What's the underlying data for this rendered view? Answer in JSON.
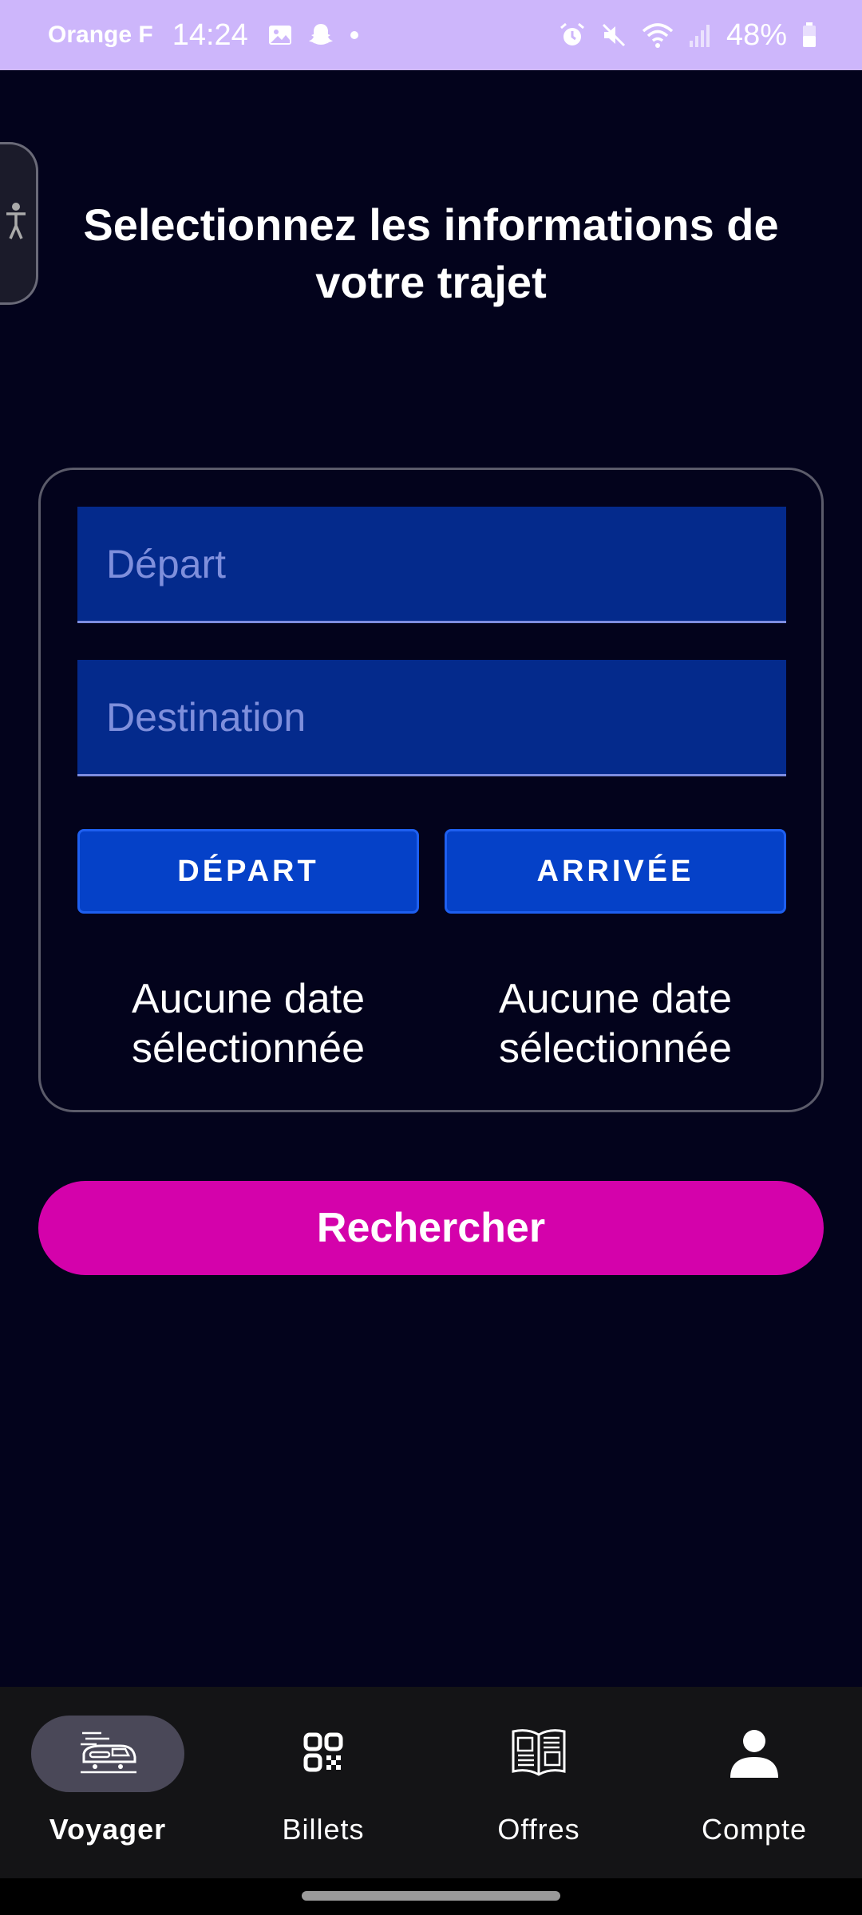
{
  "status_bar": {
    "carrier": "Orange F",
    "time": "14:24",
    "battery": "48%",
    "icons": [
      "image-icon",
      "snapchat-icon",
      "dot-icon",
      "alarm-icon",
      "mute-icon",
      "wifi-icon",
      "signal-icon",
      "battery-icon"
    ]
  },
  "page": {
    "title": "Selectionnez les informations de votre trajet"
  },
  "form": {
    "depart_placeholder": "Départ",
    "destination_placeholder": "Destination",
    "depart_button": "DÉPART",
    "arrivee_button": "ARRIVÉE",
    "depart_date_text": "Aucune date sélectionnée",
    "arrivee_date_text": "Aucune date sélectionnée"
  },
  "search_button": "Rechercher",
  "bottom_nav": {
    "items": [
      {
        "label": "Voyager",
        "icon": "train-icon",
        "active": true
      },
      {
        "label": "Billets",
        "icon": "qr-code-icon",
        "active": false
      },
      {
        "label": "Offres",
        "icon": "book-icon",
        "active": false
      },
      {
        "label": "Compte",
        "icon": "person-icon",
        "active": false
      }
    ]
  },
  "colors": {
    "background": "#03031c",
    "status_bar": "#cdb6fb",
    "field": "#042a8c",
    "date_button": "#0541c8",
    "search_button": "#d402ab",
    "nav_background": "#141416"
  }
}
